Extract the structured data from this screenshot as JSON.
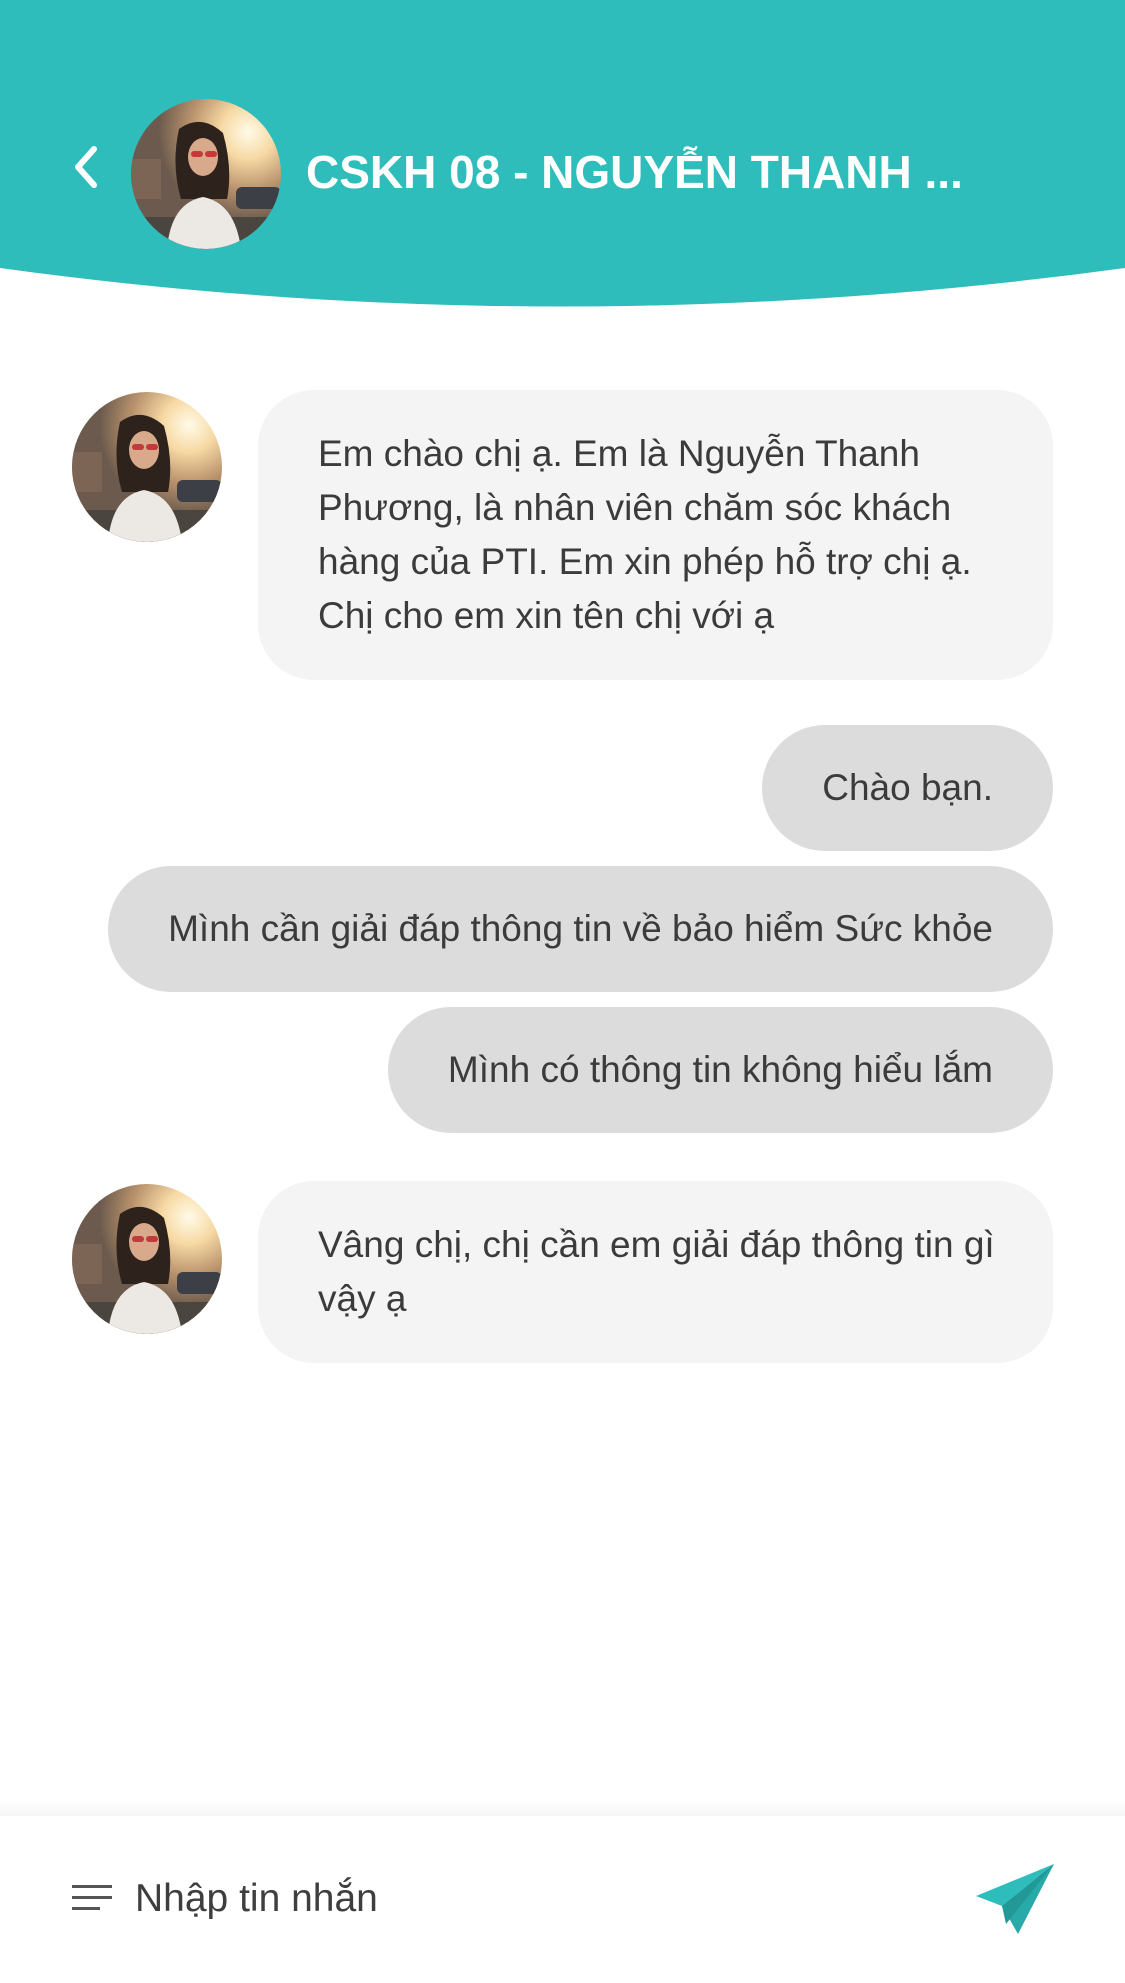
{
  "colors": {
    "accent": "#2fbdbb",
    "incoming_bubble": "#f4f4f4",
    "outgoing_bubble": "#dcdcdc",
    "text": "#3b3b3b"
  },
  "header": {
    "back_icon": "chevron-left-icon",
    "title": "CSKH 08 - NGUYỄN THANH ..."
  },
  "messages": [
    {
      "direction": "incoming",
      "text": "Em chào chị ạ. Em là Nguyễn Thanh Phương, là nhân viên chăm sóc khách hàng của PTI. Em xin phép hỗ trợ chị ạ. Chị cho em xin tên chị với ạ"
    },
    {
      "direction": "outgoing",
      "text": "Chào bạn."
    },
    {
      "direction": "outgoing",
      "text": "Mình cần giải đáp thông tin về bảo hiểm Sức khỏe"
    },
    {
      "direction": "outgoing",
      "text": "Mình có thông tin không hiểu lắm"
    },
    {
      "direction": "incoming",
      "text": "Vâng chị, chị cần em giải đáp thông tin gì vậy ạ"
    }
  ],
  "composer": {
    "menu_icon": "menu-lines-icon",
    "placeholder": "Nhập tin nhắn",
    "send_icon": "paper-plane-icon"
  }
}
